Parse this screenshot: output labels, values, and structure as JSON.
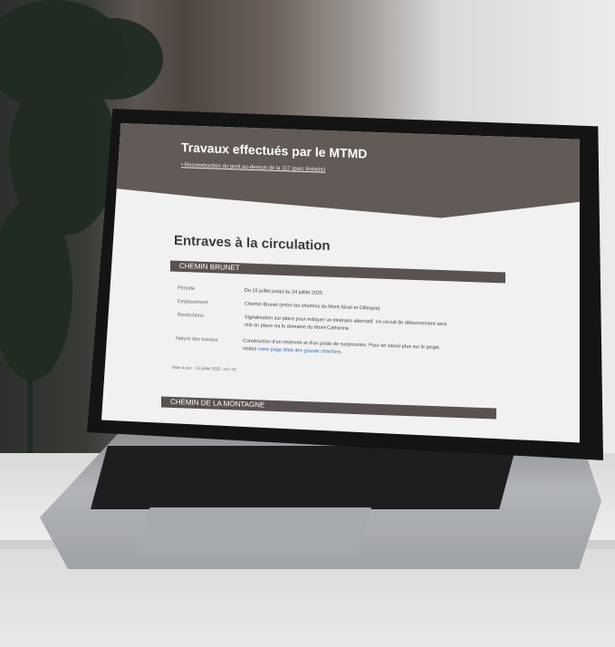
{
  "header": {
    "title": "Travaux effectués par le MTMD",
    "link_bullet": "•",
    "link_text": "Reconstruction du pont au-dessus de la 117 (parc linéaire)"
  },
  "main": {
    "title": "Entraves à la circulation",
    "sections": [
      {
        "name": "CHEMIN BRUNET",
        "rows": [
          {
            "key": "Période",
            "value": "Du 15 juillet jusqu'au 24 juillet 2025"
          },
          {
            "key": "Emplacement",
            "value": "Chemin Brunet (entre les chemins du Mont-Sinaï et Gillespie)"
          },
          {
            "key": "Restrictions",
            "value": "Signalisation sur place pour indiquer un itinéraire alternatif. Un circuit de détournement sera",
            "value2": "mis en place via le domaine du Mont-Catherine."
          },
          {
            "key": "Nature des travaux",
            "value": "Construction d'un réservoir et d'un poste de surpression. Pour en savoir plus sur le projet,",
            "value2_prefix": "visitez ",
            "link": "notre page Web des grands chantiers",
            "value2_suffix": "."
          }
        ],
        "updated": "Mise à jour : 15 juillet 2025, 14 h 32"
      },
      {
        "name": "CHEMIN DE LA MONTAGNE"
      }
    ]
  },
  "colors": {
    "header_bg": "#615a57",
    "section_bar": "#5a5250",
    "link": "#2c6fb0",
    "screen_bg": "#f1f1f1"
  }
}
